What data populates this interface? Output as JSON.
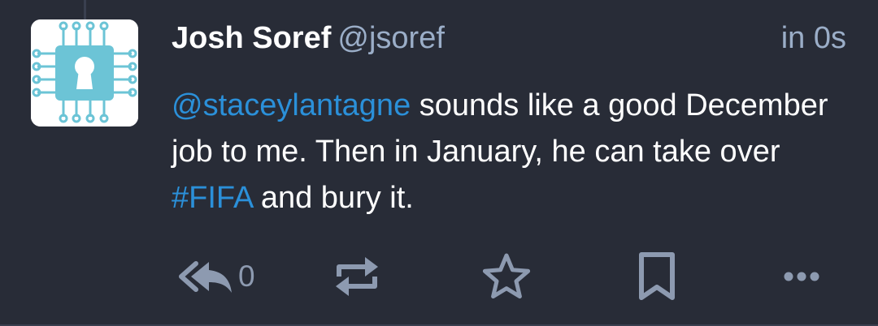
{
  "status": {
    "display_name": "Josh Soref",
    "acct": "@jsoref",
    "timestamp": "in 0s",
    "content": {
      "mention": "@staceylantagne",
      "text_1": " sounds like a good December job to me. Then in January, he can take over ",
      "hashtag": "#FIFA",
      "text_2": " and bury it."
    },
    "actions": {
      "reply_count": "0",
      "reply_icon": "reply-all-icon",
      "boost_icon": "retweet-icon",
      "favourite_icon": "star-outline-icon",
      "bookmark_icon": "bookmark-outline-icon",
      "more_icon": "ellipsis-icon"
    }
  },
  "colors": {
    "background": "#282c37",
    "text": "#ffffff",
    "secondary_text": "#9baec8",
    "link": "#2b90d9",
    "icon": "#8d9ab0",
    "avatar_accent": "#6cc4d6"
  }
}
